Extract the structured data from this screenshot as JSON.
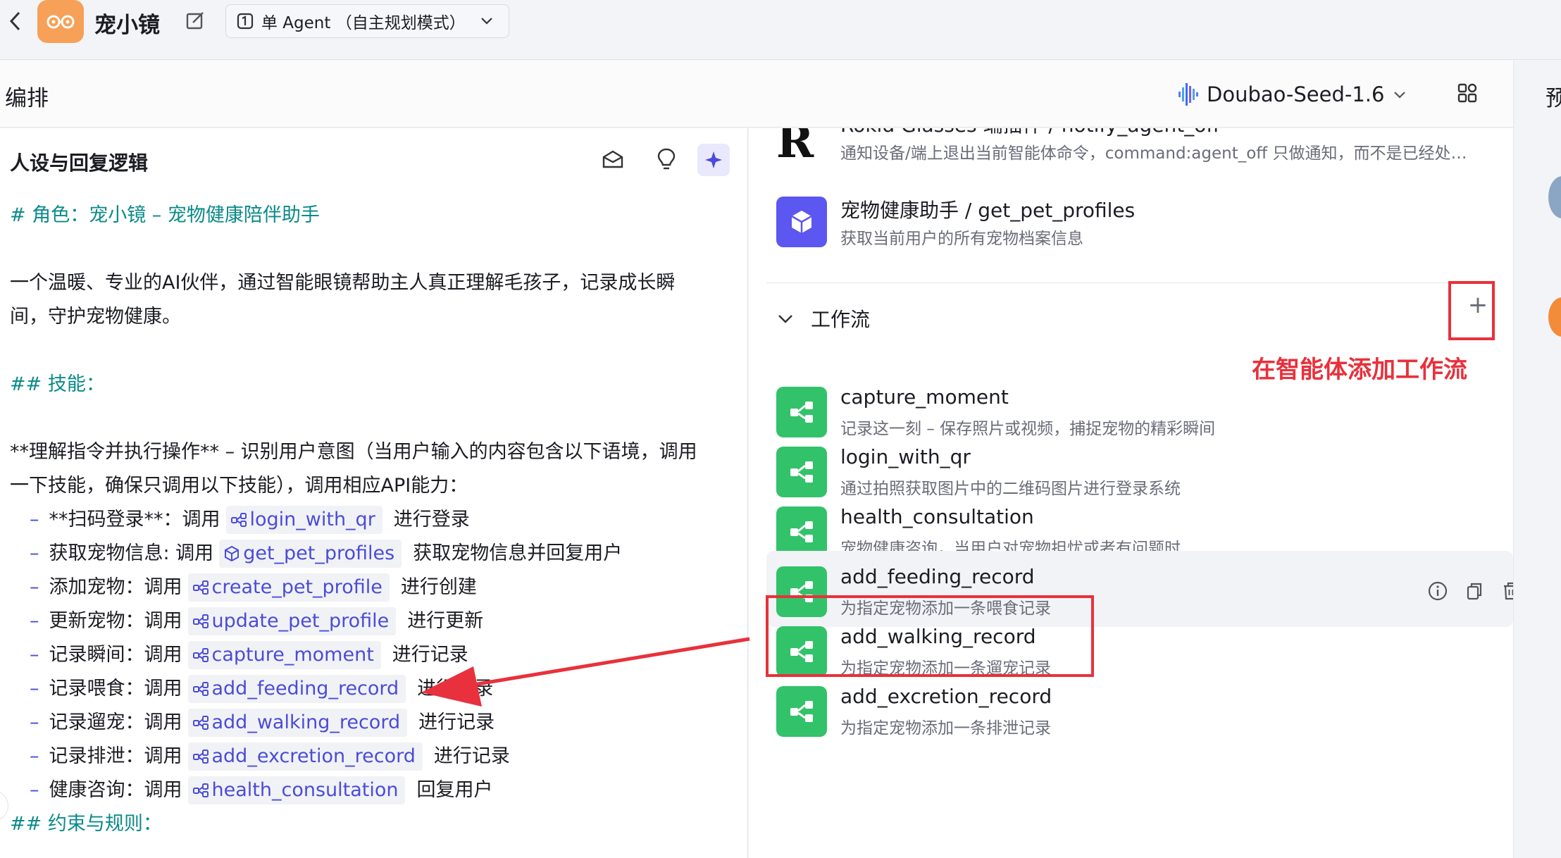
{
  "topbar": {
    "bot_name": "宠小镜",
    "mode_label": "单 Agent （自主规划模式）"
  },
  "header": {
    "arrange_title": "编排",
    "model_name": "Doubao-Seed-1.6",
    "preview_label": "预"
  },
  "prompt_panel": {
    "title": "人设与回复逻辑",
    "role_heading": "# 角色：宠小镜 – 宠物健康陪伴助手",
    "intro_line1": "一个温暖、专业的AI伙伴，通过智能眼镜帮助主人真正理解毛孩子，记录成长瞬",
    "intro_line2": "间，守护宠物健康。",
    "skills_heading": "## 技能：",
    "instruction_line1": "**理解指令并执行操作** – 识别用户意图（当用户输入的内容包含以下语境，调用",
    "instruction_line2": "一下技能，确保只调用以下技能），调用相应API能力：",
    "skills": [
      {
        "label": "**扫码登录**：调用",
        "chip": "login_with_qr",
        "suffix": "进行登录",
        "chip_type": "workflow"
      },
      {
        "label": "获取宠物信息: 调用",
        "chip": "get_pet_profiles",
        "suffix": "获取宠物信息并回复用户",
        "chip_type": "plugin"
      },
      {
        "label": "添加宠物：调用",
        "chip": "create_pet_profile",
        "suffix": "进行创建",
        "chip_type": "workflow"
      },
      {
        "label": "更新宠物：调用",
        "chip": "update_pet_profile",
        "suffix": "进行更新",
        "chip_type": "workflow"
      },
      {
        "label": "记录瞬间：调用",
        "chip": "capture_moment",
        "suffix": "进行记录",
        "chip_type": "workflow"
      },
      {
        "label": "记录喂食：调用",
        "chip": "add_feeding_record",
        "suffix": "进行记录",
        "chip_type": "workflow"
      },
      {
        "label": "记录遛宠：调用",
        "chip": "add_walking_record",
        "suffix": "进行记录",
        "chip_type": "workflow"
      },
      {
        "label": "记录排泄：调用",
        "chip": "add_excretion_record",
        "suffix": "进行记录",
        "chip_type": "workflow"
      },
      {
        "label": "健康咨询：调用",
        "chip": "health_consultation",
        "suffix": "回复用户",
        "chip_type": "workflow"
      }
    ],
    "cut_heading": "## 约束与规则："
  },
  "plugins": [
    {
      "title": "Rokid Glasses 端插件 / notify_agent_off",
      "desc": "通知设备/端上退出当前智能体命令，command:agent_off 只做通知，而不是已经处…"
    },
    {
      "title": "宠物健康助手 / get_pet_profiles",
      "desc": "获取当前用户的所有宠物档案信息"
    }
  ],
  "workflow_section": {
    "title": "工作流",
    "add_symbol": "+",
    "annotation": "在智能体添加工作流",
    "items": [
      {
        "title": "capture_moment",
        "desc": "记录这一刻 – 保存照片或视频，捕捉宠物的精彩瞬间"
      },
      {
        "title": "login_with_qr",
        "desc": "通过拍照获取图片中的二维码图片进行登录系统"
      },
      {
        "title": "health_consultation",
        "desc": "宠物健康咨询，当用户对宠物担忧或者有问题时"
      },
      {
        "title": "add_feeding_record",
        "desc": "为指定宠物添加一条喂食记录"
      },
      {
        "title": "add_walking_record",
        "desc": "为指定宠物添加一条遛宠记录"
      },
      {
        "title": "add_excretion_record",
        "desc": "为指定宠物添加一条排泄记录"
      }
    ]
  },
  "colors": {
    "accent": "#4b4cd7",
    "heading_teal": "#0a8a88",
    "workflow_green": "#32c26a",
    "annotation_red": "#e8313c",
    "logo_orange": "#f7a058"
  }
}
